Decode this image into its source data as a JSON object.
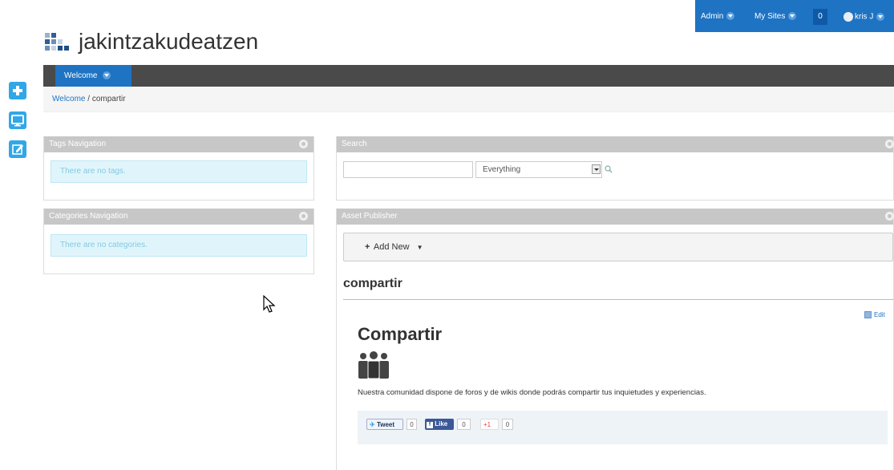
{
  "dockbar": {
    "admin_label": "Admin",
    "mysites_label": "My Sites",
    "notifications_count": "0",
    "user_label": "kris J"
  },
  "site": {
    "name": "jakintzakudeatzen"
  },
  "nav": {
    "items": [
      {
        "label": "Welcome"
      }
    ]
  },
  "breadcrumb": {
    "parent": "Welcome",
    "separator": "/",
    "current": "compartir"
  },
  "side_buttons": [
    {
      "icon": "add-icon"
    },
    {
      "icon": "monitor-icon"
    },
    {
      "icon": "edit-icon"
    }
  ],
  "portlets": {
    "tags": {
      "title": "Tags Navigation",
      "message": "There are no tags."
    },
    "categories": {
      "title": "Categories Navigation",
      "message": "There are no categories."
    },
    "search": {
      "title": "Search",
      "input_value": "",
      "scope_selected": "Everything"
    },
    "asset_publisher": {
      "title": "Asset Publisher",
      "add_new_label": "Add New",
      "asset_title": "compartir",
      "edit_label": "Edit",
      "content_title": "Compartir",
      "content_text": "Nuestra comunidad dispone de foros y de wikis donde podrás compartir tus inquietudes y experiencias.",
      "share": {
        "tweet_label": "Tweet",
        "tweet_count": "0",
        "like_label": "Like",
        "like_count": "0",
        "gplus_label": "+1",
        "gplus_count": "0"
      }
    }
  },
  "colors": {
    "accent": "#1e73c3",
    "nav_bg": "#4a4a4a",
    "portlet_header": "#c7c7c7",
    "info_bg": "#e0f5fb",
    "side_button": "#31a7e8"
  }
}
